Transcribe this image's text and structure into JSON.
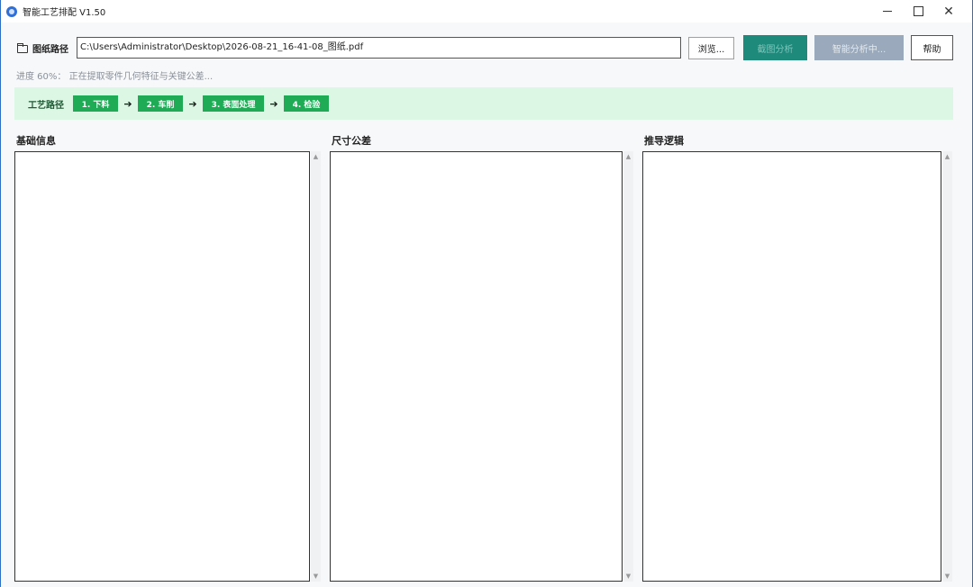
{
  "window": {
    "title": "智能工艺排配  V1.50"
  },
  "toolbar": {
    "path_label": "图纸路径",
    "path_value": "C:\\Users\\Administrator\\Desktop\\2026-08-21_16-41-08_图纸.pdf",
    "browse_label": "浏览...",
    "analyze_label": "截图分析",
    "smart_label": "智能分析中...",
    "help_label": "帮助"
  },
  "progress": {
    "percent": 60,
    "text": "进度 60%： 正在提取零件几何特征与关键公差..."
  },
  "route": {
    "label": "工艺路径",
    "steps": [
      "1. 下料",
      "2. 车削",
      "3. 表面处理",
      "4. 检验"
    ],
    "arrow": "➔"
  },
  "panels": {
    "basic": {
      "title": "基础信息"
    },
    "tolerance": {
      "title": "尺寸公差"
    },
    "logic": {
      "title": "推导逻辑"
    }
  },
  "colors": {
    "analyze_bg": "#1e8a7c",
    "smart_bg": "#9aa9bb",
    "route_bg": "#dcf7e4",
    "step_bg": "#1faa55"
  }
}
